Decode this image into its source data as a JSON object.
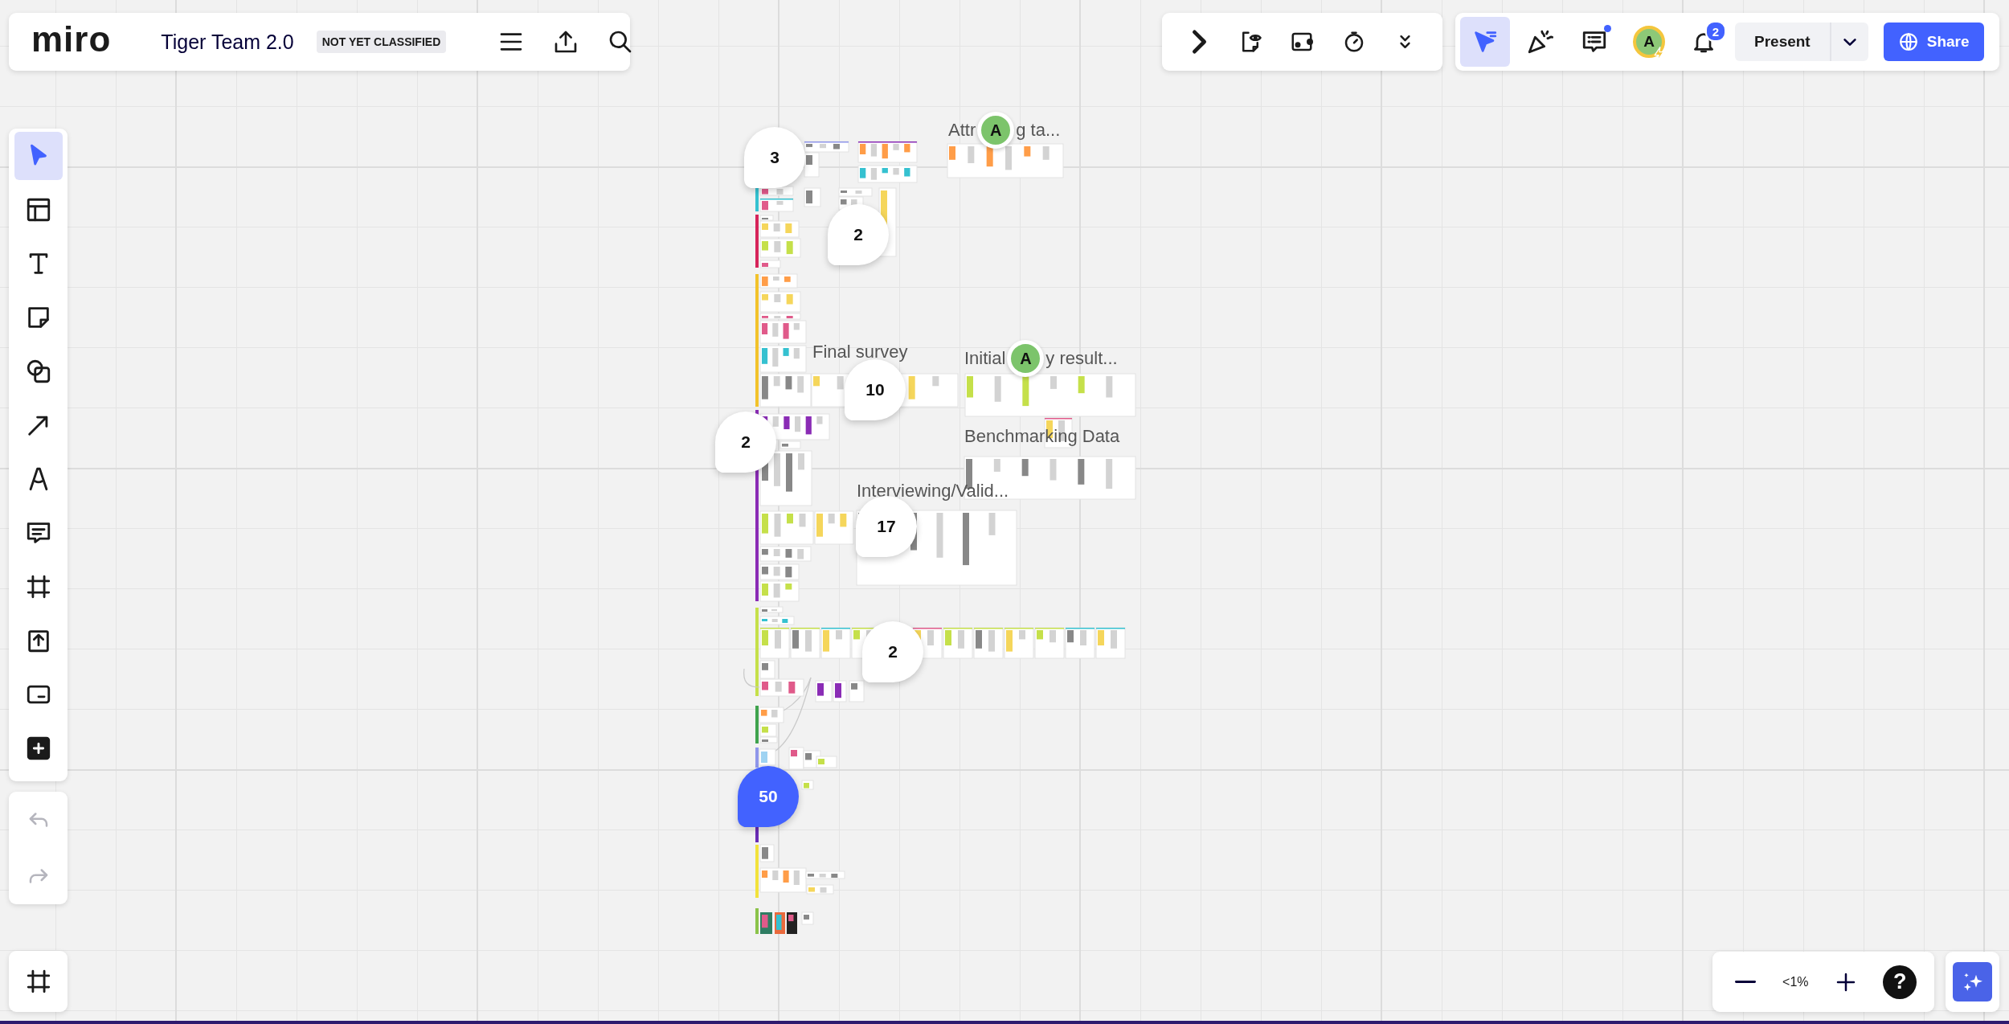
{
  "header": {
    "logo": "miro",
    "board_title": "Tiger Team 2.0",
    "classification": "NOT YET CLASSIFIED"
  },
  "header_tools": [
    {
      "kind": "menu"
    },
    {
      "kind": "export"
    },
    {
      "kind": "search"
    }
  ],
  "apps_tools": [
    {
      "kind": "expand"
    },
    {
      "kind": "reveal"
    },
    {
      "kind": "card"
    },
    {
      "kind": "timer"
    },
    {
      "kind": "more"
    }
  ],
  "collab_tools": [
    {
      "kind": "cursors",
      "selected": true
    },
    {
      "kind": "celebrate",
      "selected": false
    },
    {
      "kind": "comments",
      "selected": false,
      "unread": true
    }
  ],
  "user": {
    "avatar": "A",
    "notifications": "2"
  },
  "present": "Present",
  "share": "Share",
  "tools": [
    {
      "kind": "select",
      "selected": true
    },
    {
      "kind": "templates",
      "selected": false
    },
    {
      "kind": "text",
      "selected": false
    },
    {
      "kind": "sticky",
      "selected": false
    },
    {
      "kind": "shapes",
      "selected": false
    },
    {
      "kind": "line",
      "selected": false
    },
    {
      "kind": "pen",
      "selected": false
    },
    {
      "kind": "comment",
      "selected": false
    },
    {
      "kind": "frame",
      "selected": false
    },
    {
      "kind": "upload",
      "selected": false
    },
    {
      "kind": "card",
      "selected": false
    },
    {
      "kind": "more",
      "selected": false
    }
  ],
  "history": [
    {
      "kind": "undo",
      "disabled": true
    },
    {
      "kind": "redo",
      "disabled": true
    }
  ],
  "zoom": {
    "label": "<1%",
    "help": "?"
  },
  "canvas": {
    "frame_titles": [
      {
        "parts": [
          "Attr",
          "g ta..."
        ],
        "collaborator": "A"
      },
      {
        "parts": [
          "Final survey"
        ]
      },
      {
        "parts": [
          "Initial",
          "y result..."
        ],
        "collaborator": "A"
      },
      {
        "parts": [
          "Benchmarking Data"
        ]
      },
      {
        "parts": [
          "Interviewing/Valid..."
        ]
      }
    ],
    "comments": [
      {
        "count": "3",
        "unread": false
      },
      {
        "count": "2",
        "unread": false
      },
      {
        "count": "10",
        "unread": false
      },
      {
        "count": "2",
        "unread": false
      },
      {
        "count": "17",
        "unread": false
      },
      {
        "count": "2",
        "unread": false
      },
      {
        "count": "50",
        "unread": true
      }
    ]
  }
}
